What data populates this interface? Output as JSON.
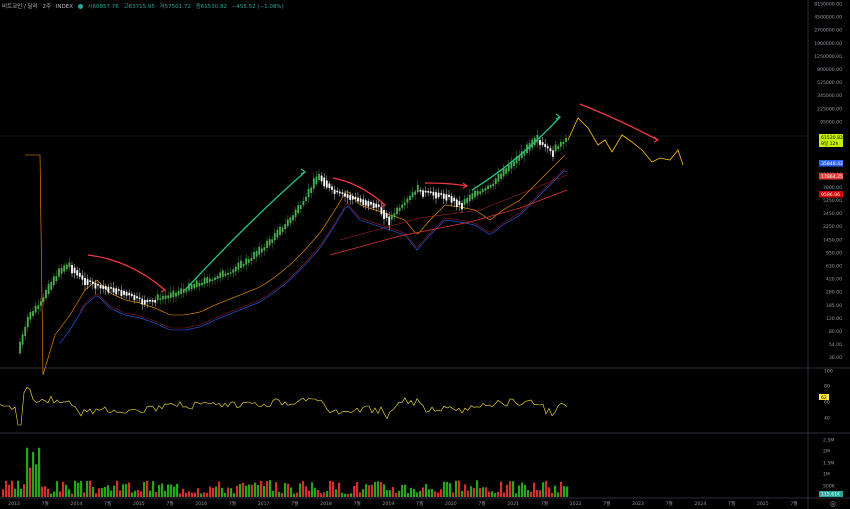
{
  "header": {
    "symbol": "비트코인 / 달러",
    "interval": "2주",
    "exchange": "INDEX",
    "open": "시60857.76",
    "high": "고63715.95",
    "low": "저57501.72",
    "close": "종61530.82",
    "change": "−455.52 (−1.08%)"
  },
  "price_axis": {
    "labels": [
      "8150000.00",
      "4500000.00",
      "2700000.00",
      "1900000.00",
      "1250000.00",
      "800000.00",
      "525000.00",
      "345000.00",
      "225000.00",
      "95000.00",
      "",
      "",
      "",
      "12000.00",
      "7800.00",
      "5250.00",
      "3450.00",
      "2250.00",
      "1450.00",
      "950.00",
      "630.00",
      "420.00",
      "280.00",
      "185.00",
      "120.00",
      "80.00",
      "54.00",
      "36.00"
    ]
  },
  "price_badges": [
    {
      "label": "61530.82",
      "sub": "9일 12h",
      "color": "#c6ee00",
      "text_color": "#000000"
    },
    {
      "label": "35848.42",
      "color": "#2962ff",
      "text_color": "#ffffff"
    },
    {
      "label": "17864.25",
      "color": "#e53935",
      "text_color": "#ffffff"
    },
    {
      "label": "9586.96",
      "color": "#d50000",
      "text_color": "#ffffff"
    }
  ],
  "rsi_axis": {
    "labels": [
      "100",
      "80",
      "62",
      "60",
      "40"
    ],
    "badge": "62",
    "badge_color": "#ffeb3b"
  },
  "volume_axis": {
    "labels": [
      "2.5M",
      "2M",
      "1.5M",
      "1M",
      "500K"
    ],
    "badge": "115.61K",
    "badge_color": "#26a69a"
  },
  "time_axis": {
    "labels": [
      "2013",
      "7월",
      "2014",
      "7월",
      "2015",
      "7월",
      "2016",
      "7월",
      "2017",
      "7월",
      "2018",
      "7월",
      "2019",
      "7월",
      "2020",
      "7월",
      "2021",
      "7월",
      "2022",
      "7월",
      "2023",
      "7월",
      "2024",
      "7월",
      "2025",
      "7월"
    ]
  },
  "icons": {
    "settings": "gear-icon"
  },
  "colors": {
    "background": "#000000",
    "up": "#26a69a",
    "candle_up": "#4caf50",
    "candle_down": "#ffffff",
    "down": "#ef5350",
    "rsi": "#ffeb3b",
    "projection": "#ffc107",
    "ema_blue": "#2962ff",
    "ma_red": "#e53935",
    "ma_orange": "#ff9800",
    "arrow_green": "#26c281",
    "arrow_red": "#f23645"
  }
}
